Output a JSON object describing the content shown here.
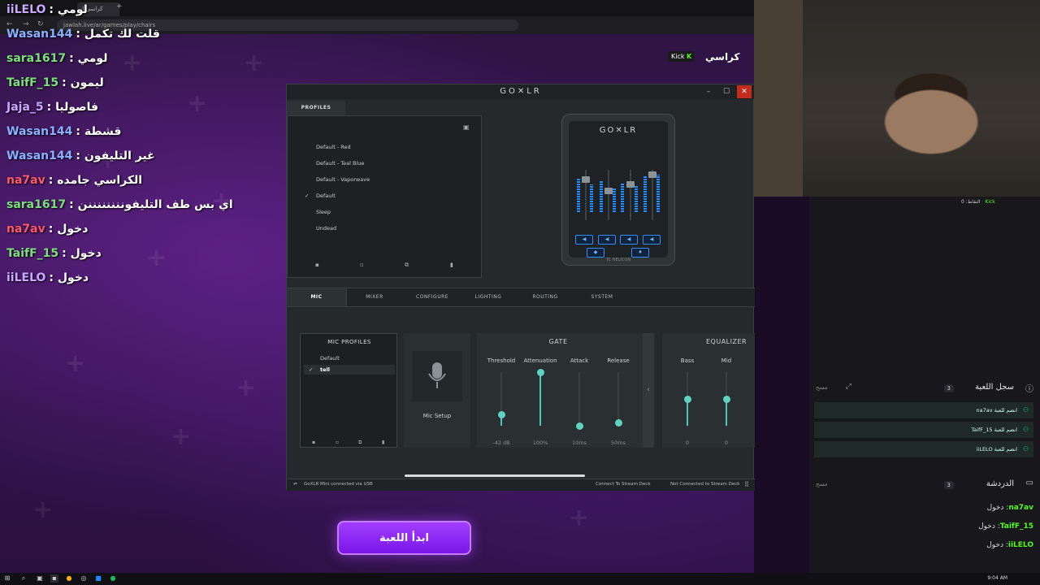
{
  "browser": {
    "tab_title": "كراسي | جولة",
    "new_tab": "+",
    "url": "jawlah.live/ar/games/play/chairs"
  },
  "site": {
    "game_title": "كراسي",
    "kick_label": "Kick",
    "kick_logo": "K"
  },
  "chat_overlay": [
    {
      "user": "iiLELO",
      "msg": ": لومي",
      "color": "#c9a9ff"
    },
    {
      "user": "Wasan144",
      "msg": ": قلت لك تكمل",
      "color": "#8ab0ff"
    },
    {
      "user": "sara1617",
      "msg": ": لومي",
      "color": "#7be07b"
    },
    {
      "user": "TaifF_15",
      "msg": ": ليمون",
      "color": "#7be07b"
    },
    {
      "user": "Jaja_5",
      "msg": ": فاصوليا",
      "color": "#c9a9ff"
    },
    {
      "user": "Wasan144",
      "msg": ": قشطة",
      "color": "#8ab0ff"
    },
    {
      "user": "Wasan144",
      "msg": ": غير التليفون",
      "color": "#8ab0ff"
    },
    {
      "user": "na7av",
      "msg": ": الكراسي جامده",
      "color": "#ff5a6a"
    },
    {
      "user": "sara1617",
      "msg": ": اي بس طف التليفوننننننننن",
      "color": "#7be07b"
    },
    {
      "user": "na7av",
      "msg": ": دخول",
      "color": "#ff5a6a"
    },
    {
      "user": "TaifF_15",
      "msg": ": دخول",
      "color": "#7be07b"
    },
    {
      "user": "iiLELO",
      "msg": ": دخول",
      "color": "#c9a9ff"
    }
  ],
  "start_button": "ابدأ اللعبة",
  "goxlr": {
    "logo": "GO✕LR",
    "profiles_tab": "PROFILES",
    "profiles": [
      {
        "name": "Default - Red",
        "checked": false
      },
      {
        "name": "Default - Teal Blue",
        "checked": false
      },
      {
        "name": "Default - Vaporwave",
        "checked": false
      },
      {
        "name": "Default",
        "checked": true
      },
      {
        "name": "Sleep",
        "checked": false
      },
      {
        "name": "Undead",
        "checked": false
      }
    ],
    "device_logo": "GO✕LR",
    "device_brand": "TC HELICON",
    "tabs": [
      "MIC",
      "MIXER",
      "CONFIGURE",
      "LIGHTING",
      "ROUTING",
      "SYSTEM"
    ],
    "mic_profiles_title": "MIC PROFILES",
    "mic_profiles": [
      {
        "name": "Default",
        "checked": false
      },
      {
        "name": "tell",
        "checked": true
      }
    ],
    "mic_setup_label": "Mic Setup",
    "gate": {
      "title": "GATE",
      "controls": [
        {
          "label": "Threshold",
          "value": "-42 dB",
          "level": 0.2
        },
        {
          "label": "Attenuation",
          "value": "100%",
          "level": 1.0
        },
        {
          "label": "Attack",
          "value": "10ms",
          "level": 0.0
        },
        {
          "label": "Release",
          "value": "50ms",
          "level": 0.05
        }
      ]
    },
    "eq": {
      "title": "EQUALIZER",
      "controls": [
        {
          "label": "Bass",
          "value": "0",
          "level": 0.5
        },
        {
          "label": "Mid",
          "value": "0",
          "level": 0.5
        }
      ]
    },
    "status_left": "GoXLR Mini connected via USB",
    "status_stream_deck": "Connect To Stream Deck",
    "status_not_connected": "Not Connected to Stream Deck",
    "accent": "#5ed3c2"
  },
  "right_panel": {
    "points": "النقاط: 0",
    "kick": "Kick",
    "game_log_title": "سجل اللعبة",
    "game_log_count": "3",
    "clear_label": "مسح",
    "game_log": [
      "na7av انضم للعبة",
      "TaifF_15 انضم للعبة",
      "iiLELO انضم للعبة"
    ],
    "chat_title": "الدردشة",
    "chat_count": "3",
    "chat": [
      {
        "user": "na7av",
        "msg": "دخول"
      },
      {
        "user": "TaifF_15",
        "msg": "دخول"
      },
      {
        "user": "iiLELO",
        "msg": "دخول"
      }
    ]
  },
  "taskbar": {
    "time": "9:04 AM"
  }
}
